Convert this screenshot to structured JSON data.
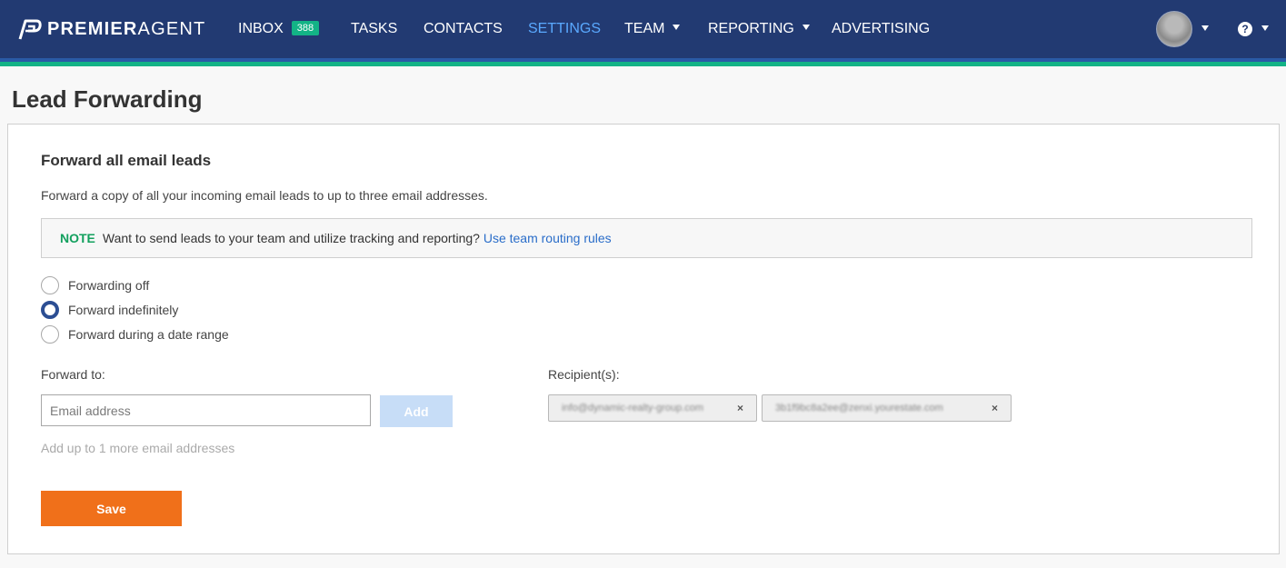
{
  "brand": {
    "bold": "PREMIER",
    "light": "AGENT",
    "logo_icon": "premier-agent-logo-icon"
  },
  "nav": {
    "inbox": {
      "label": "INBOX",
      "badge": "388"
    },
    "tasks": "TASKS",
    "contacts": "CONTACTS",
    "settings": "SETTINGS",
    "team": "TEAM",
    "reporting": "REPORTING",
    "advertising": "ADVERTISING",
    "help_icon": "?",
    "active_color": "#5aa9ff"
  },
  "page": {
    "title": "Lead Forwarding"
  },
  "section": {
    "title": "Forward all email leads",
    "description": "Forward a copy of all your incoming email leads to up to three email addresses."
  },
  "note": {
    "label": "NOTE",
    "text": "Want to send leads to your team and utilize tracking and reporting?",
    "link": "Use team routing rules"
  },
  "forwarding_options": [
    {
      "label": "Forwarding off",
      "checked": false
    },
    {
      "label": "Forward indefinitely",
      "checked": true
    },
    {
      "label": "Forward during a date range",
      "checked": false
    }
  ],
  "forward_to": {
    "label": "Forward to:",
    "placeholder": "Email address",
    "value": "",
    "add_label": "Add",
    "hint": "Add up to 1 more email addresses"
  },
  "recipients": {
    "label": "Recipient(s):",
    "items": [
      {
        "email": "info@dynamic-realty-group.com",
        "remove": "×"
      },
      {
        "email": "3b1f9bc8a2ee@zenxi.yourestate.com",
        "remove": "×"
      }
    ]
  },
  "actions": {
    "save_label": "Save"
  },
  "colors": {
    "navbar": "#223a72",
    "accent_green": "#13b386",
    "link_blue": "#2a6dc9",
    "save_orange": "#f0701a",
    "add_disabled": "#c7ddf7"
  }
}
